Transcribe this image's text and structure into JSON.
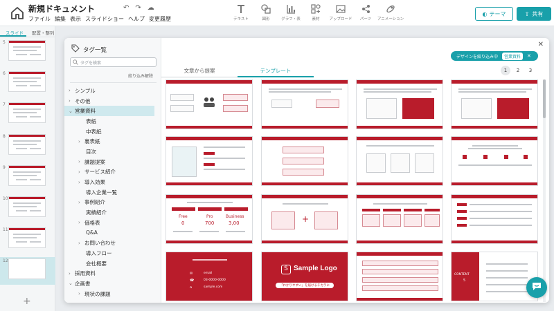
{
  "header": {
    "doc_title": "新規ドキュメント",
    "menu": [
      "ファイル",
      "編集",
      "表示",
      "スライドショー",
      "ヘルプ",
      "変更履歴"
    ],
    "tools": [
      {
        "icon": "text-icon",
        "label": "テキスト"
      },
      {
        "icon": "shape-icon",
        "label": "図形"
      },
      {
        "icon": "chart-icon",
        "label": "グラフ・表"
      },
      {
        "icon": "material-icon",
        "label": "素材"
      },
      {
        "icon": "upload-icon",
        "label": "アップロード"
      },
      {
        "icon": "parts-icon",
        "label": "パーツ"
      },
      {
        "icon": "animation-icon",
        "label": "アニメーション"
      }
    ],
    "theme_label": "テーマ",
    "share_label": "共有",
    "accent_color": "#19a0aa",
    "brand_red": "#b91c2b"
  },
  "slide_panel": {
    "tabs": [
      "スライド",
      "配置・整列"
    ],
    "slides": [
      {
        "num": "5"
      },
      {
        "num": "6"
      },
      {
        "num": "7"
      },
      {
        "num": "8"
      },
      {
        "num": "9"
      },
      {
        "num": "10"
      },
      {
        "num": "11"
      },
      {
        "num": "12"
      }
    ],
    "add_label": "+"
  },
  "modal": {
    "tag_title": "タグ一覧",
    "search_placeholder": "タグを検索",
    "clear_filter": "絞り込み解除",
    "tags": [
      {
        "label": "シンプル",
        "kind": "collapsed",
        "level": "lvl0"
      },
      {
        "label": "その他",
        "kind": "collapsed",
        "level": "lvl0"
      },
      {
        "label": "営業資料",
        "kind": "expanded",
        "level": "lvl0",
        "active": true
      },
      {
        "label": "表紙",
        "kind": "leaf",
        "level": "leaf"
      },
      {
        "label": "中表紙",
        "kind": "leaf",
        "level": "leaf"
      },
      {
        "label": "裏表紙",
        "kind": "collapsed",
        "level": "lvl1"
      },
      {
        "label": "目次",
        "kind": "leaf",
        "level": "leaf"
      },
      {
        "label": "課題提案",
        "kind": "collapsed",
        "level": "lvl1"
      },
      {
        "label": "サービス紹介",
        "kind": "collapsed",
        "level": "lvl1"
      },
      {
        "label": "導入効果",
        "kind": "collapsed",
        "level": "lvl1"
      },
      {
        "label": "導入企業一覧",
        "kind": "leaf",
        "level": "leaf"
      },
      {
        "label": "事例紹介",
        "kind": "collapsed",
        "level": "lvl1"
      },
      {
        "label": "実績紹介",
        "kind": "leaf",
        "level": "leaf"
      },
      {
        "label": "価格表",
        "kind": "collapsed",
        "level": "lvl1"
      },
      {
        "label": "Q&A",
        "kind": "leaf",
        "level": "leaf"
      },
      {
        "label": "お問い合わせ",
        "kind": "collapsed",
        "level": "lvl1"
      },
      {
        "label": "導入フロー",
        "kind": "leaf",
        "level": "leaf"
      },
      {
        "label": "会社概要",
        "kind": "leaf",
        "level": "leaf"
      },
      {
        "label": "採用資料",
        "kind": "collapsed",
        "level": "lvl0"
      },
      {
        "label": "企画書",
        "kind": "expanded",
        "level": "lvl0"
      },
      {
        "label": "現状の課題",
        "kind": "collapsed",
        "level": "lvl1"
      }
    ],
    "tabs": [
      "文章から提案",
      "テンプレート"
    ],
    "active_tab": 1,
    "design_filter_label": "デザインを絞り込み中",
    "design_filter_tag": "営業資料",
    "pages": [
      "1",
      "2",
      "3"
    ],
    "current_page": "1",
    "price_plans": [
      {
        "name": "Free",
        "price": "0"
      },
      {
        "name": "Pro",
        "price": "700"
      },
      {
        "name": "Business",
        "price": "3,00"
      }
    ],
    "sample_logo": "Sample Logo",
    "cover_tagline": "「わかりやすい」を届けるチカラに",
    "contact_lines": [
      "email",
      "03-0000-0000",
      "sample.com"
    ],
    "content_label": "CONTENT",
    "content_number": "5",
    "step_numbers": [
      "01",
      "02",
      "03",
      "04",
      "05"
    ],
    "cover_sub": "サービス名"
  }
}
